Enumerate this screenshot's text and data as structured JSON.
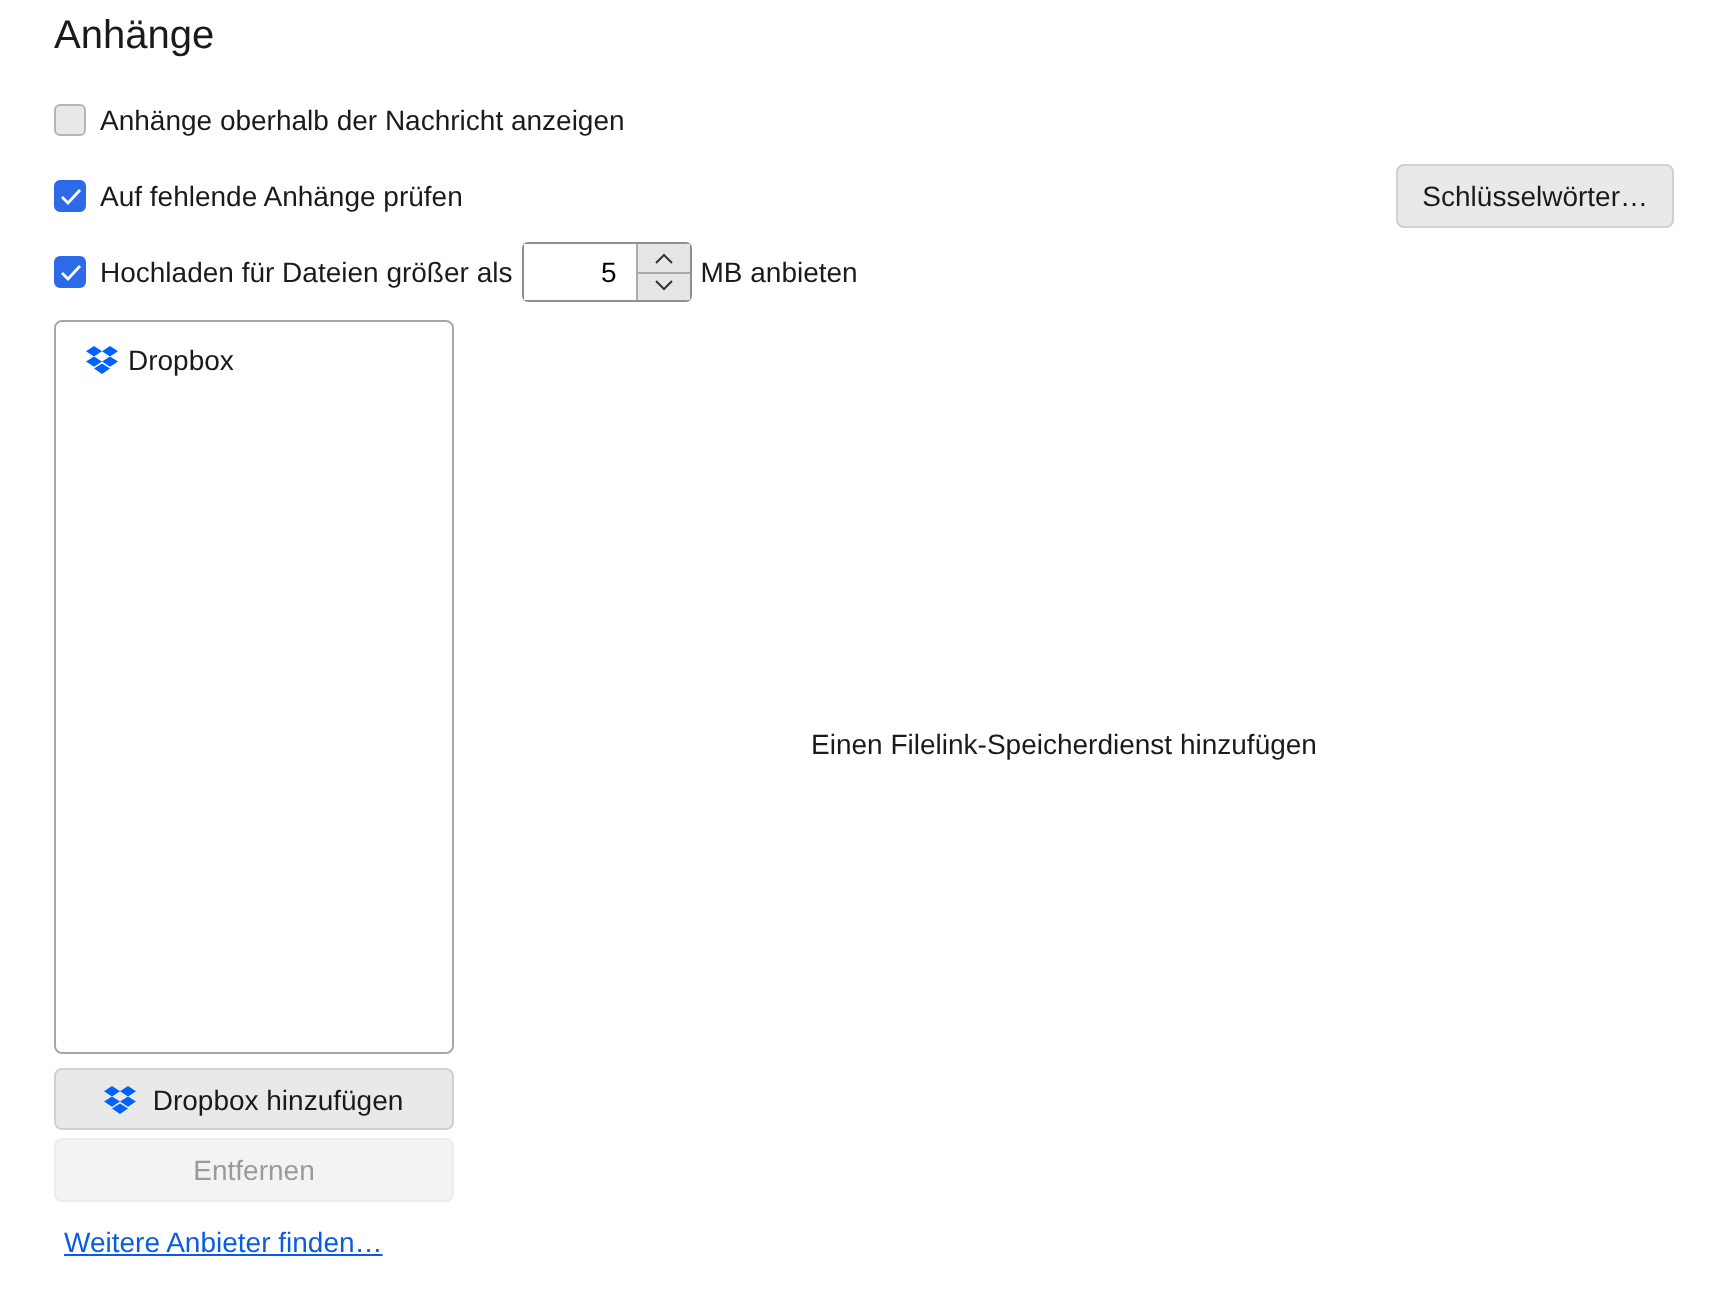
{
  "title": "Anhänge",
  "options": [
    {
      "label": "Anhänge oberhalb der Nachricht anzeigen",
      "checked": false
    },
    {
      "label": "Auf fehlende Anhänge prüfen",
      "checked": true,
      "button": "Schlüsselwörter…"
    },
    {
      "label": "Hochladen für Dateien größer als",
      "checked": true,
      "size": "5",
      "unit": "MB anbieten"
    }
  ],
  "providers": [
    {
      "name": "Dropbox"
    }
  ],
  "add_button": "Dropbox hinzufügen",
  "remove_button": {
    "label": "Entfernen",
    "disabled": true
  },
  "link": "Weitere Anbieter finden…",
  "message": "Einen Filelink-Speicherdienst hinzufügen"
}
